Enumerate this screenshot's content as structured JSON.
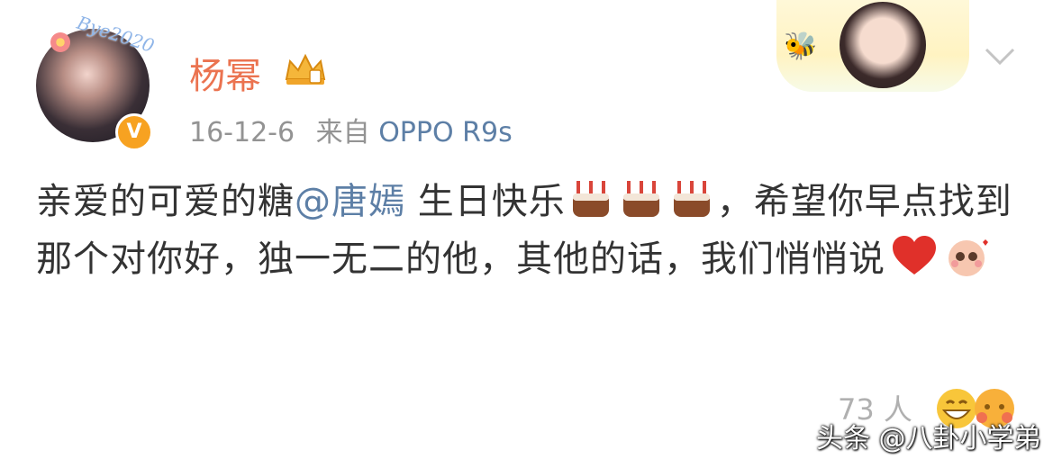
{
  "user": {
    "avatar_caption": "Bye2020",
    "name": "杨幂",
    "vip_badge": "V"
  },
  "meta": {
    "date": "16-12-6",
    "from_label": "来自",
    "source": "OPPO R9s"
  },
  "post": {
    "text_part1": "亲爱的可爱的糖",
    "mention": "@唐嫣",
    "text_part2": " 生日快乐",
    "text_part3": "，希望你早点找到那个对你好，独一无二的他，其他的话，我们悄悄说",
    "icons": [
      "cake-icon",
      "cake-icon",
      "cake-icon",
      "red-heart-icon",
      "shy-emoji-icon"
    ]
  },
  "reactions": {
    "count_text": "73 人",
    "icons": [
      "grin-emoji-icon",
      "hug-emoji-icon"
    ]
  },
  "watermark": "头条 @八卦小学弟",
  "colors": {
    "username": "#eb7350",
    "link": "#5d7fa6",
    "meta": "#939393",
    "body": "#333333",
    "badge": "#f7a221"
  }
}
